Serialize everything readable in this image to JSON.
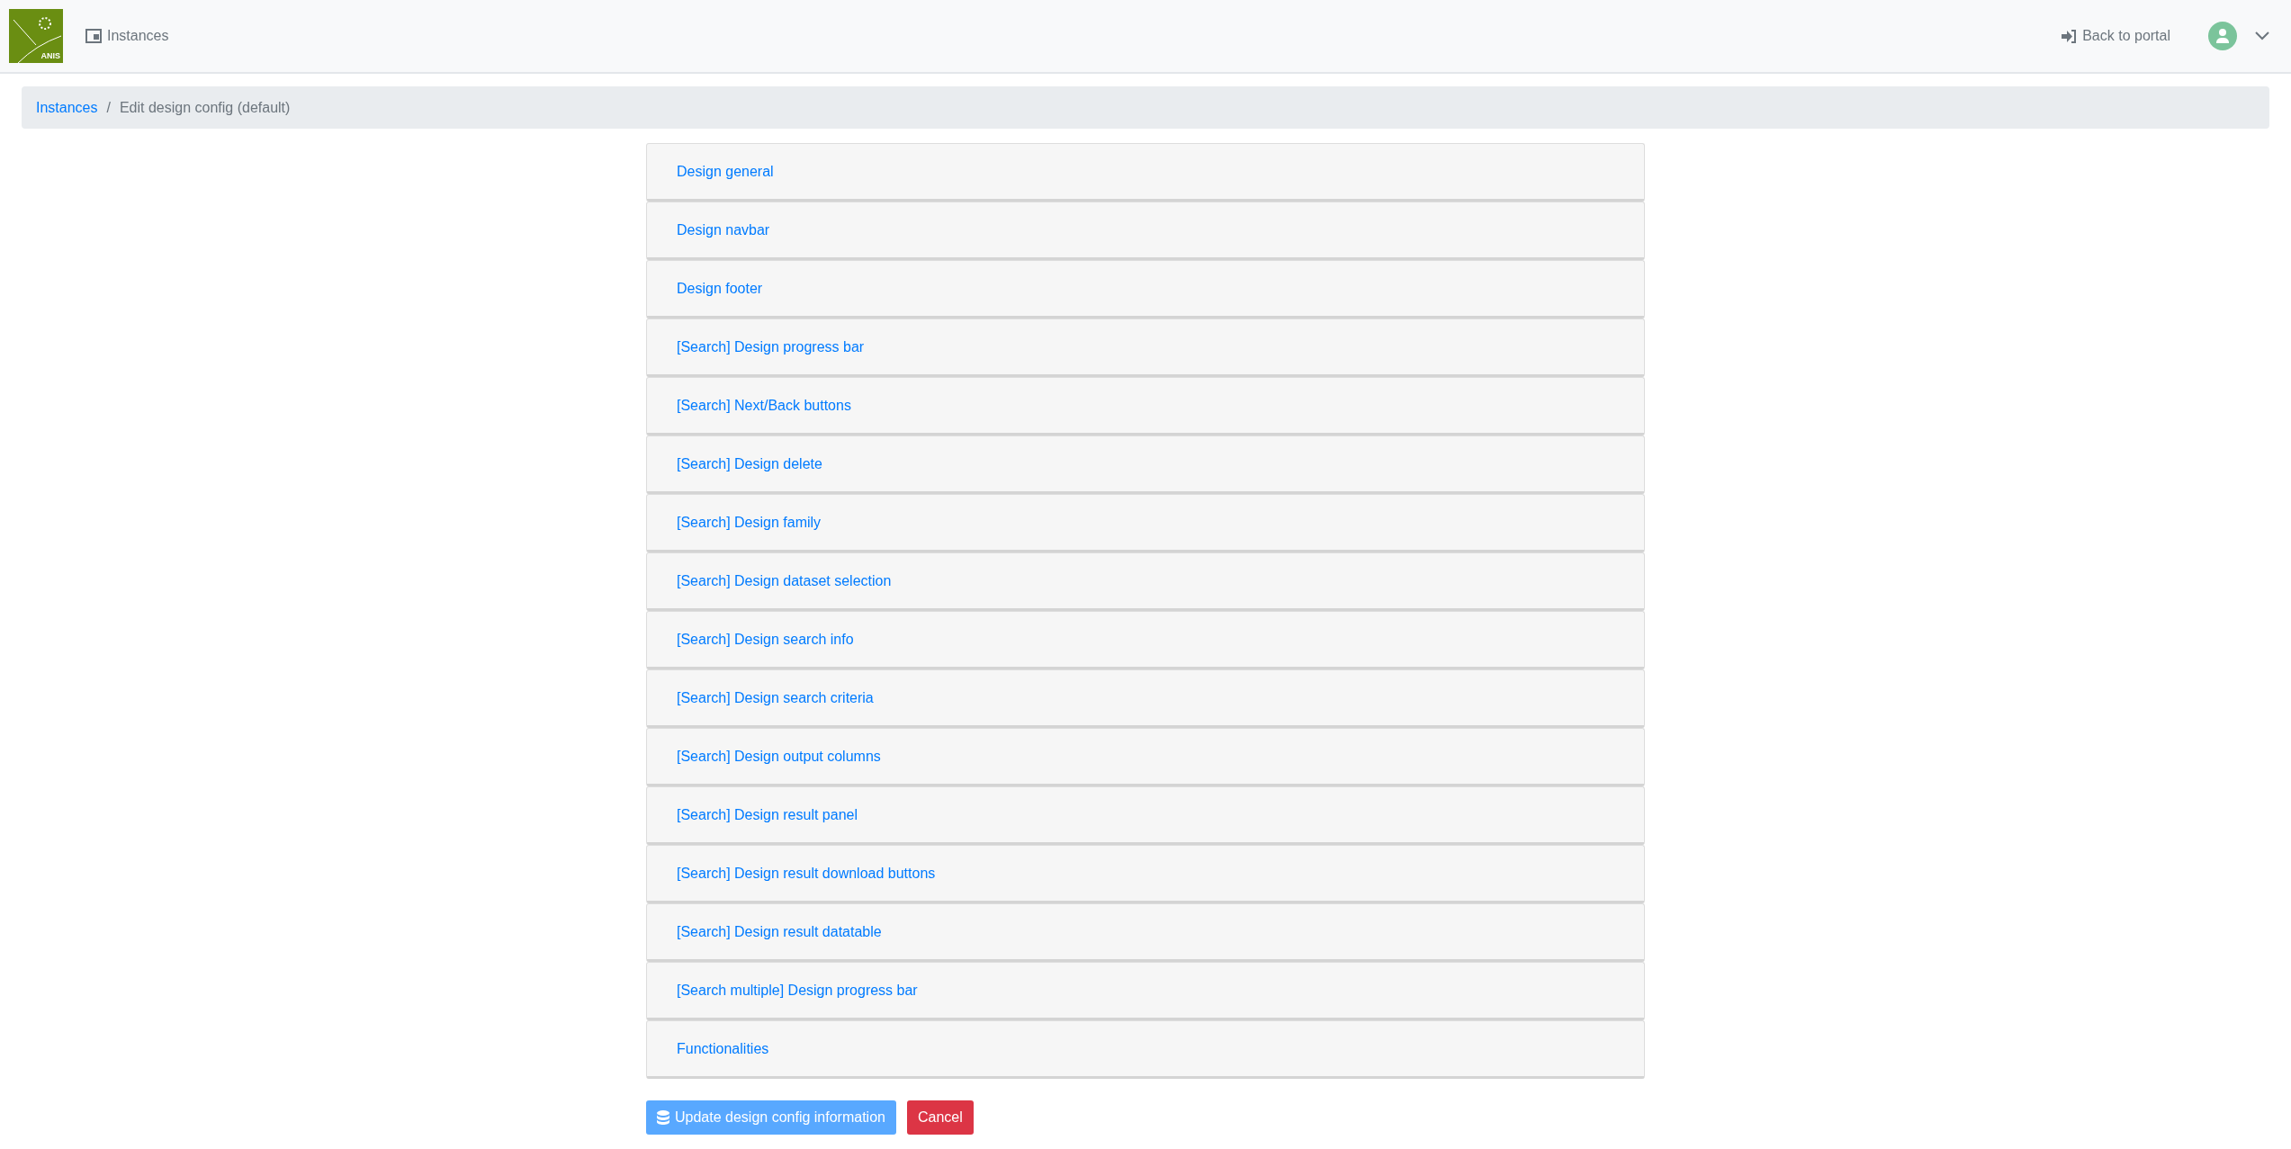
{
  "navbar": {
    "logo": {
      "text": "ANIS"
    },
    "links": [
      {
        "label": "Instances"
      }
    ],
    "back_link": {
      "label": "Back to portal"
    }
  },
  "breadcrumb_separator": "/",
  "breadcrumb": [
    {
      "label": "Instances",
      "kind": "link"
    },
    {
      "label": "Edit design config (default)",
      "kind": "current"
    }
  ],
  "sections": [
    {
      "title": "Design general"
    },
    {
      "title": "Design navbar"
    },
    {
      "title": "Design footer"
    },
    {
      "title": "[Search] Design progress bar"
    },
    {
      "title": "[Search] Next/Back buttons"
    },
    {
      "title": "[Search] Design delete"
    },
    {
      "title": "[Search] Design family"
    },
    {
      "title": "[Search] Design dataset selection"
    },
    {
      "title": "[Search] Design search info"
    },
    {
      "title": "[Search] Design search criteria"
    },
    {
      "title": "[Search] Design output columns"
    },
    {
      "title": "[Search] Design result panel"
    },
    {
      "title": "[Search] Design result download buttons"
    },
    {
      "title": "[Search] Design result datatable"
    },
    {
      "title": "[Search multiple] Design progress bar"
    },
    {
      "title": "Functionalities"
    }
  ],
  "buttons": [
    {
      "label": "Update design config information",
      "kind": "submit",
      "disabled": true
    },
    {
      "label": "Cancel",
      "kind": "cancel",
      "disabled": false
    }
  ]
}
